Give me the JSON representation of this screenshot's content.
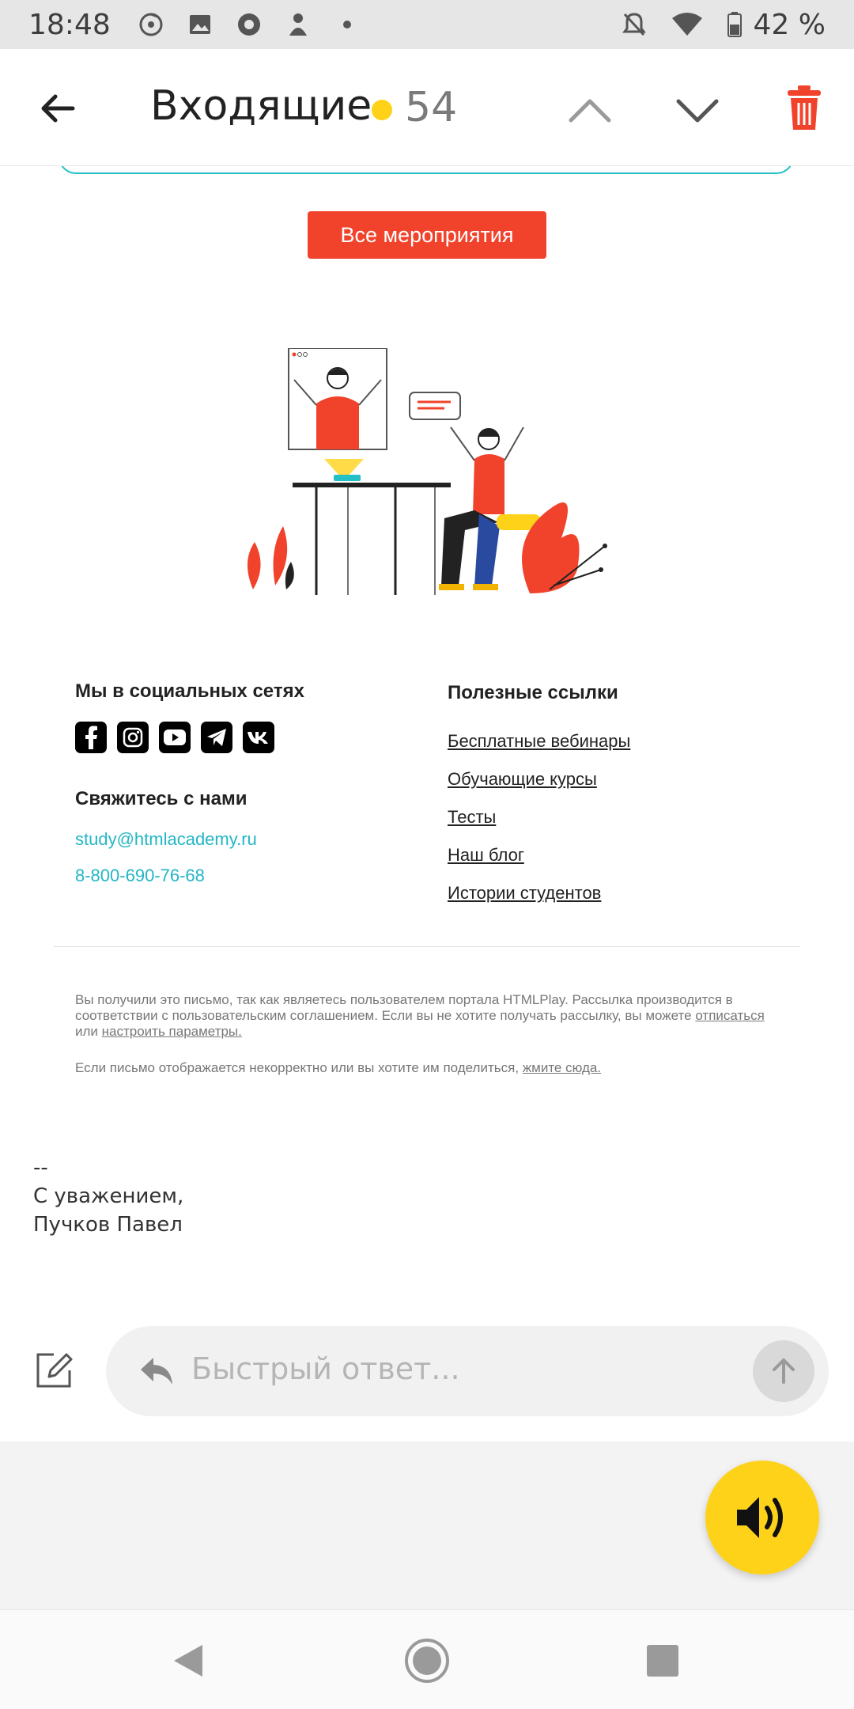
{
  "status_bar": {
    "time": "18:48",
    "icons_left": [
      "music-icon",
      "image-icon",
      "camera-icon",
      "person-icon",
      "dot-icon"
    ],
    "icons_right": [
      "notifications-off-icon",
      "wifi-icon",
      "battery-icon"
    ],
    "battery": "42 %"
  },
  "header": {
    "title": "Входящие",
    "unread_count": "54",
    "dot_color": "#ffd21a",
    "trash_color": "#f1432b"
  },
  "email": {
    "events_button": "Все мероприятия",
    "social_heading": "Мы в социальных сетях",
    "social_icons": [
      "facebook-icon",
      "instagram-icon",
      "youtube-icon",
      "telegram-icon",
      "vk-icon"
    ],
    "contact_heading": "Свяжитесь с нами",
    "contact_email": "study@htmlacademy.ru",
    "contact_phone": "8-800-690-76-68",
    "links_heading": "Полезные ссылки",
    "links": [
      "Бесплатные вебинары",
      "Обучающие курсы",
      "Тесты",
      "Наш блог",
      "Истории студентов"
    ],
    "legal_text_1": "Вы получили это письмо, так как являетесь пользователем портала HTMLPlay. Рассылка производится в соответствии с пользовательским соглашением. Если вы не хотите получать рассылку, вы можете ",
    "legal_unsubscribe": "отписаться",
    "legal_or": " или ",
    "legal_settings": "настроить параметры.",
    "legal_text_2": "Если письмо отображается некорректно или вы хотите им поделиться, ",
    "legal_click_here": "жмите сюда.",
    "accent_color": "#f1432b",
    "link_color": "#23b6c5"
  },
  "signature": {
    "dashes": "--",
    "regards": "С уважением,",
    "name": "Пучков Павел"
  },
  "quick_reply": {
    "placeholder": "Быстрый ответ..."
  },
  "fab_color": "#ffd21a"
}
